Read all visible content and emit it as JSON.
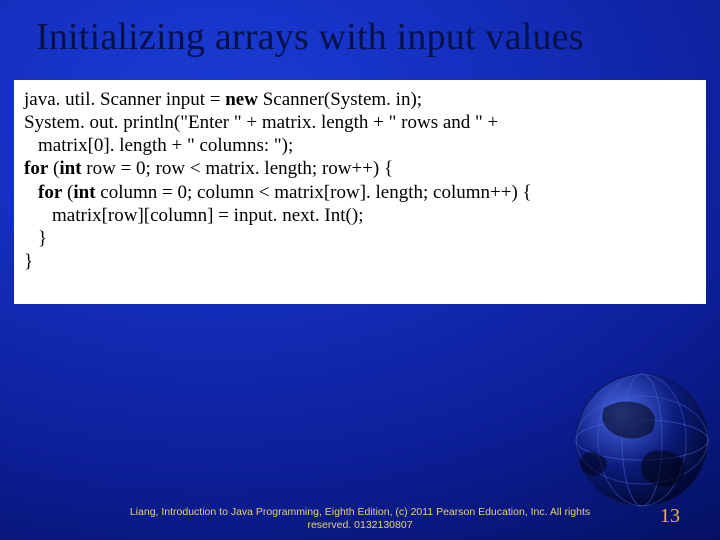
{
  "title": "Initializing arrays with input values",
  "code": {
    "l1a": "java. util. Scanner input = ",
    "l1b": "new",
    "l1c": " Scanner(System. in);",
    "l2": "System. out. println(\"Enter \" + matrix. length + \" rows and \" +",
    "l3": "matrix[0]. length + \" columns: \");",
    "l4a": "for",
    "l4b": " (",
    "l4c": "int",
    "l4d": " row = 0; row < matrix. length; row++) {",
    "l5a": "for",
    "l5b": " (",
    "l5c": "int",
    "l5d": " column = 0; column < matrix[row]. length; column++) {",
    "l6": "matrix[row][column] = input. next. Int();",
    "l7": "}",
    "l8": "}"
  },
  "footer": "Liang, Introduction to Java Programming, Eighth Edition, (c) 2011 Pearson Education, Inc. All rights reserved. 0132130807",
  "page_number": "13"
}
